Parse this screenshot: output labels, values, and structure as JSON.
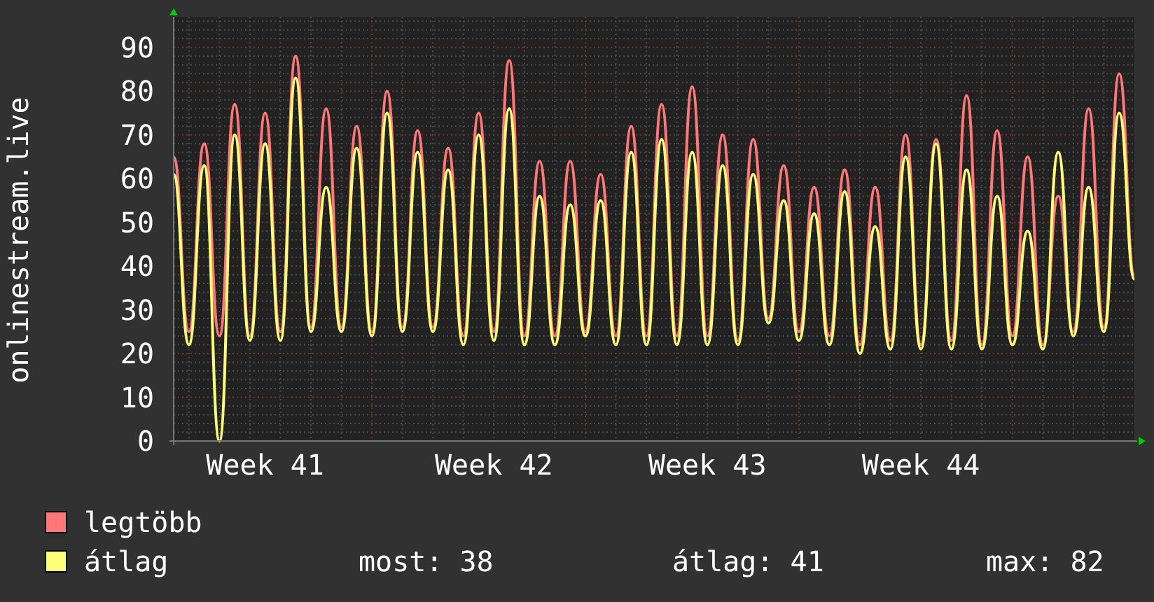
{
  "chart": {
    "chart_data": {
      "type": "line",
      "ylabel": "onlinestream.live",
      "grid": true,
      "categories": [
        null,
        null,
        null,
        null,
        null,
        null,
        "Week 41",
        null,
        null,
        null,
        null,
        null,
        null,
        null,
        null,
        null,
        null,
        null,
        null,
        null,
        null,
        "Week 42",
        null,
        null,
        null,
        null,
        null,
        null,
        null,
        null,
        null,
        null,
        null,
        null,
        null,
        "Week 43",
        null,
        null,
        null,
        null,
        null,
        null,
        null,
        null,
        null,
        null,
        null,
        null,
        null,
        "Week 44",
        null,
        null,
        null,
        null,
        null,
        null,
        null,
        null,
        null,
        null,
        null,
        null,
        null,
        null
      ],
      "ylim": [
        0,
        97
      ],
      "yticks": [
        0,
        10,
        20,
        30,
        40,
        50,
        60,
        70,
        80,
        90
      ],
      "series": [
        {
          "name": "legtöbb",
          "color": "#ff7777",
          "values": [
            65,
            25,
            68,
            24,
            77,
            24,
            75,
            25,
            88,
            26,
            76,
            26,
            72,
            25,
            80,
            26,
            71,
            26,
            67,
            24,
            75,
            25,
            87,
            24,
            64,
            24,
            64,
            25,
            61,
            24,
            72,
            24,
            77,
            24,
            81,
            24,
            70,
            23,
            69,
            28,
            63,
            25,
            58,
            24,
            62,
            22,
            58,
            23,
            70,
            22,
            69,
            23,
            79,
            22,
            71,
            24,
            65,
            22,
            56,
            25,
            76,
            26,
            84,
            38
          ]
        },
        {
          "name": "átlag",
          "color": "#ffff77",
          "values": [
            61,
            22,
            63,
            0,
            70,
            23,
            68,
            23,
            83,
            25,
            58,
            25,
            67,
            24,
            75,
            25,
            66,
            25,
            62,
            22,
            70,
            23,
            76,
            22,
            56,
            22,
            54,
            24,
            55,
            22,
            66,
            22,
            69,
            22,
            66,
            22,
            63,
            22,
            61,
            27,
            55,
            23,
            52,
            22,
            57,
            20,
            49,
            21,
            65,
            21,
            68,
            21,
            62,
            21,
            56,
            22,
            48,
            21,
            66,
            24,
            58,
            25,
            75,
            37
          ]
        }
      ]
    }
  },
  "stats": [
    "most: 38",
    "átlag: 41",
    "max: 82"
  ]
}
